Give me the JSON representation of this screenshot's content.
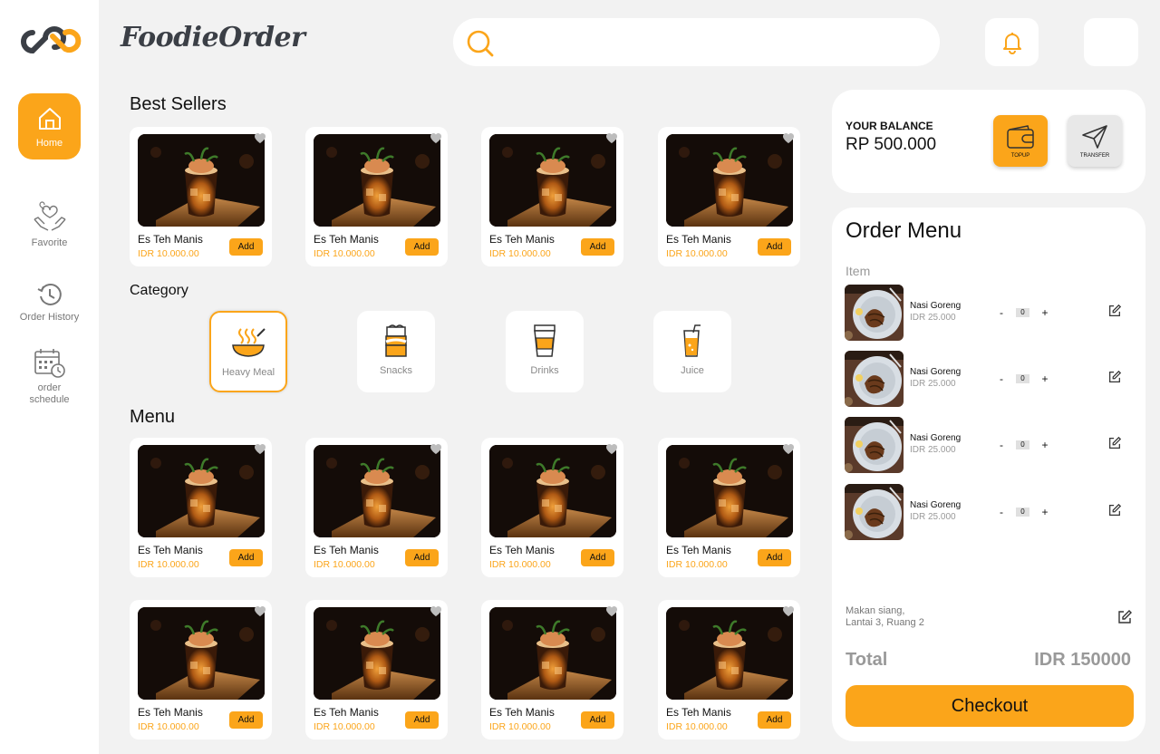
{
  "app": {
    "brand": "FoodieOrder"
  },
  "colors": {
    "accent": "#FBA51A",
    "background": "#F2F2F2",
    "card": "#FFFFFF",
    "price": "#FBA51A"
  },
  "search": {
    "placeholder": "",
    "value": ""
  },
  "sidebar": {
    "items": [
      {
        "label": "Home",
        "icon": "home-icon",
        "active": true
      },
      {
        "label": "Favorite",
        "icon": "favorite-icon",
        "active": false
      },
      {
        "label": "Order  History",
        "icon": "history-icon",
        "active": false
      },
      {
        "label": "order schedule",
        "icon": "calendar-clock-icon",
        "active": false
      }
    ]
  },
  "best_sellers": {
    "title": "Best Sellers",
    "items": [
      {
        "name": "Es Teh Manis",
        "price": "IDR 10.000.00",
        "add_label": "Add"
      },
      {
        "name": "Es Teh Manis",
        "price": "IDR 10.000.00",
        "add_label": "Add"
      },
      {
        "name": "Es Teh Manis",
        "price": "IDR 10.000.00",
        "add_label": "Add"
      },
      {
        "name": "Es Teh Manis",
        "price": "IDR 10.000.00",
        "add_label": "Add"
      }
    ]
  },
  "category": {
    "title": "Category",
    "items": [
      {
        "label": "Heavy Meal",
        "icon": "bowl-icon",
        "active": true
      },
      {
        "label": "Snacks",
        "icon": "snacks-icon",
        "active": false
      },
      {
        "label": "Drinks",
        "icon": "drink-cup-icon",
        "active": false
      },
      {
        "label": "Juice",
        "icon": "juice-icon",
        "active": false
      }
    ]
  },
  "menu": {
    "title": "Menu",
    "items": [
      {
        "name": "Es Teh Manis",
        "price": "IDR 10.000.00",
        "add_label": "Add"
      },
      {
        "name": "Es Teh Manis",
        "price": "IDR 10.000.00",
        "add_label": "Add"
      },
      {
        "name": "Es Teh Manis",
        "price": "IDR 10.000.00",
        "add_label": "Add"
      },
      {
        "name": "Es Teh Manis",
        "price": "IDR 10.000.00",
        "add_label": "Add"
      },
      {
        "name": "Es Teh Manis",
        "price": "IDR 10.000.00",
        "add_label": "Add"
      },
      {
        "name": "Es Teh Manis",
        "price": "IDR 10.000.00",
        "add_label": "Add"
      },
      {
        "name": "Es Teh Manis",
        "price": "IDR 10.000.00",
        "add_label": "Add"
      },
      {
        "name": "Es Teh Manis",
        "price": "IDR 10.000.00",
        "add_label": "Add"
      }
    ]
  },
  "balance": {
    "label": "YOUR BALANCE",
    "amount": "RP 500.000",
    "topup_label": "TOPUP",
    "transfer_label": "TRANSFER"
  },
  "order": {
    "title": "Order Menu",
    "item_header": "Item",
    "items": [
      {
        "name": "Nasi Goreng",
        "price": "IDR 25.000",
        "qty": "0",
        "minus": "-",
        "plus": "+"
      },
      {
        "name": "Nasi Goreng",
        "price": "IDR 25.000",
        "qty": "0",
        "minus": "-",
        "plus": "+"
      },
      {
        "name": "Nasi Goreng",
        "price": "IDR 25.000",
        "qty": "0",
        "minus": "-",
        "plus": "+"
      },
      {
        "name": "Nasi Goreng",
        "price": "IDR 25.000",
        "qty": "0",
        "minus": "-",
        "plus": "+"
      }
    ],
    "note_line1": "Makan siang,",
    "note_line2": "Lantai 3, Ruang 2",
    "total_label": "Total",
    "total_value": "IDR 150000",
    "checkout_label": "Checkout"
  }
}
